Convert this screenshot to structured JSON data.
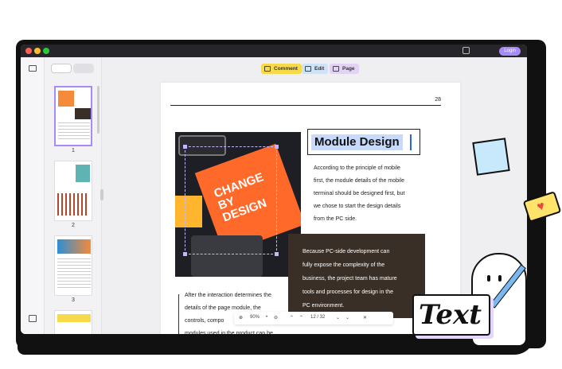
{
  "window": {
    "login_label": "Login"
  },
  "toolbar": {
    "comment_label": "Comment",
    "edit_label": "Edit",
    "page_label": "Page"
  },
  "thumbnails": [
    {
      "num": "1"
    },
    {
      "num": "2"
    },
    {
      "num": "3"
    }
  ],
  "page": {
    "number": "28",
    "title": "Module Design",
    "para1": [
      "According to the principle of mobile",
      "first, the module details of the mobile",
      "terminal should be designed first, but",
      "we chose to start the design details",
      "from the PC side."
    ],
    "para2": [
      "Because PC-side development can",
      "fully expose the complexity of the",
      "business, the project team has mature",
      "tools and processes for design in the",
      "PC environment."
    ],
    "para3": [
      "After the interaction determines the",
      "details of the page module, the",
      "controls, compo",
      "modules used in the product can be"
    ],
    "book_text": [
      "CHANGE",
      "BY",
      "DESIGN"
    ]
  },
  "pager": {
    "zoom": "90%",
    "page_indicator": "12 / 32"
  },
  "decoration": {
    "text_card": "Text"
  },
  "colors": {
    "accent": "#a78bfa",
    "comment": "#f7d94c",
    "edit": "#cfe3f7",
    "page": "#e2d3f5",
    "highlight": "#c7dafc"
  }
}
